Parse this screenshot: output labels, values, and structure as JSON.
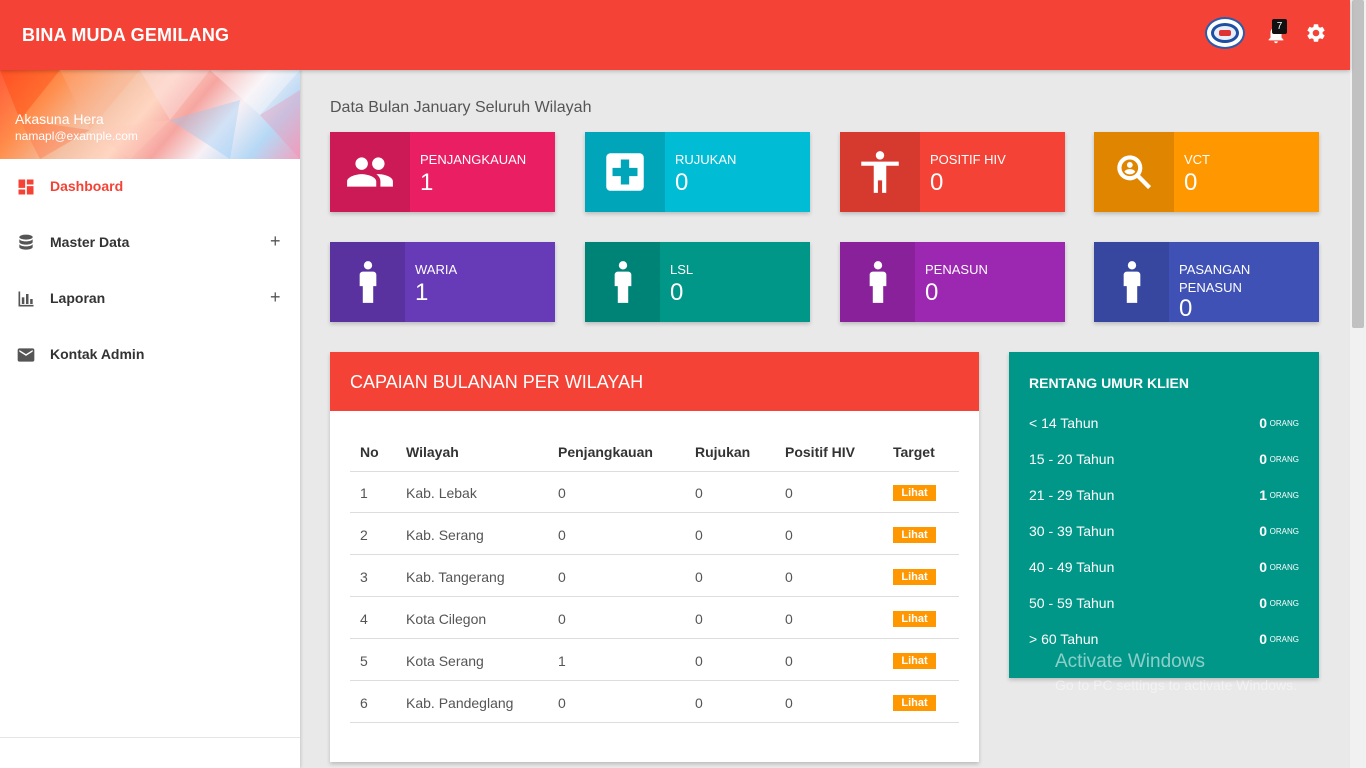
{
  "app": {
    "brand": "BINA MUDA GEMILANG",
    "notification_count": "7"
  },
  "user": {
    "name": "Akasuna Hera",
    "email": "namapl@example.com"
  },
  "sidebar": {
    "items": [
      {
        "label": "Dashboard",
        "icon": "dashboard-icon",
        "expandable": false,
        "active": true
      },
      {
        "label": "Master Data",
        "icon": "database-icon",
        "expandable": true,
        "expand_symbol": "+"
      },
      {
        "label": "Laporan",
        "icon": "bar-chart-icon",
        "expandable": true,
        "expand_symbol": "+"
      },
      {
        "label": "Kontak Admin",
        "icon": "mail-icon",
        "expandable": false
      }
    ]
  },
  "heading": "Data Bulan January Seluruh Wilayah",
  "stats": [
    {
      "label": "PENJANGKAUAN",
      "value": "1",
      "color": "#e91e63",
      "icon": "people-icon"
    },
    {
      "label": "RUJUKAN",
      "value": "0",
      "color": "#00bcd4",
      "icon": "medical-cross-icon"
    },
    {
      "label": "POSITIF HIV",
      "value": "0",
      "color": "#f44336",
      "icon": "person-icon"
    },
    {
      "label": "VCT",
      "value": "0",
      "color": "#ff9800",
      "icon": "search-person-icon"
    },
    {
      "label": "WARIA",
      "value": "1",
      "color": "#673ab7",
      "icon": "person-icon"
    },
    {
      "label": "LSL",
      "value": "0",
      "color": "#009688",
      "icon": "person-icon"
    },
    {
      "label": "PENASUN",
      "value": "0",
      "color": "#9c27b0",
      "icon": "person-icon"
    },
    {
      "label": "PASANGAN PENASUN",
      "value": "0",
      "color": "#3f51b5",
      "icon": "person-icon"
    }
  ],
  "capaian": {
    "title": "CAPAIAN BULANAN PER WILAYAH",
    "headers": [
      "No",
      "Wilayah",
      "Penjangkauan",
      "Rujukan",
      "Positif HIV",
      "Target"
    ],
    "rows": [
      {
        "no": "1",
        "wilayah": "Kab. Lebak",
        "penjangkauan": "0",
        "rujukan": "0",
        "positif": "0",
        "target": "Lihat"
      },
      {
        "no": "2",
        "wilayah": "Kab. Serang",
        "penjangkauan": "0",
        "rujukan": "0",
        "positif": "0",
        "target": "Lihat"
      },
      {
        "no": "3",
        "wilayah": "Kab. Tangerang",
        "penjangkauan": "0",
        "rujukan": "0",
        "positif": "0",
        "target": "Lihat"
      },
      {
        "no": "4",
        "wilayah": "Kota Cilegon",
        "penjangkauan": "0",
        "rujukan": "0",
        "positif": "0",
        "target": "Lihat"
      },
      {
        "no": "5",
        "wilayah": "Kota Serang",
        "penjangkauan": "1",
        "rujukan": "0",
        "positif": "0",
        "target": "Lihat"
      },
      {
        "no": "6",
        "wilayah": "Kab. Pandeglang",
        "penjangkauan": "0",
        "rujukan": "0",
        "positif": "0",
        "target": "Lihat"
      }
    ]
  },
  "umur": {
    "title": "RENTANG UMUR KLIEN",
    "unit": "ORANG",
    "rows": [
      {
        "label": "< 14 Tahun",
        "value": "0"
      },
      {
        "label": "15 - 20 Tahun",
        "value": "0"
      },
      {
        "label": "21 - 29 Tahun",
        "value": "1"
      },
      {
        "label": "30 - 39 Tahun",
        "value": "0"
      },
      {
        "label": "40 - 49 Tahun",
        "value": "0"
      },
      {
        "label": "50 - 59 Tahun",
        "value": "0"
      },
      {
        "label": "> 60 Tahun",
        "value": "0"
      }
    ]
  },
  "watermark": {
    "line1": "Activate Windows",
    "line2": "Go to PC settings to activate Windows."
  }
}
